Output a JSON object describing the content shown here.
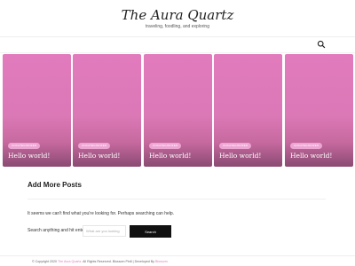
{
  "site": {
    "title": "The Aura Quartz",
    "tagline": "traveling, foodling, and exploring"
  },
  "header": {
    "search_icon": "search-icon"
  },
  "slider": {
    "slides": [
      {
        "category": "UNCATEGORIZED",
        "title": "Hello world!"
      },
      {
        "category": "UNCATEGORIZED",
        "title": "Hello world!"
      },
      {
        "category": "UNCATEGORIZED",
        "title": "Hello world!"
      },
      {
        "category": "UNCATEGORIZED",
        "title": "Hello world!"
      },
      {
        "category": "UNCATEGORIZED",
        "title": "Hello world!"
      }
    ],
    "colors": {
      "slide": "#db78b6",
      "category_badge": "#eda6d3"
    }
  },
  "section": {
    "title": "Add More Posts",
    "not_found_message": "It seems we can't find what you're looking for. Perhaps searching can help."
  },
  "search": {
    "label": "Search anything and hit enter.",
    "placeholder": "What are you looking",
    "button_label": "Search"
  },
  "footer": {
    "prefix": "© Copyright 2020",
    "site_link": "The Aura Quartz",
    "middle": ". All Rights Reserved. Blossom Pin8 | Developed By",
    "developer_link": "Blossom"
  },
  "colors": {
    "accent": "#e27bbd",
    "button": "#111111"
  }
}
